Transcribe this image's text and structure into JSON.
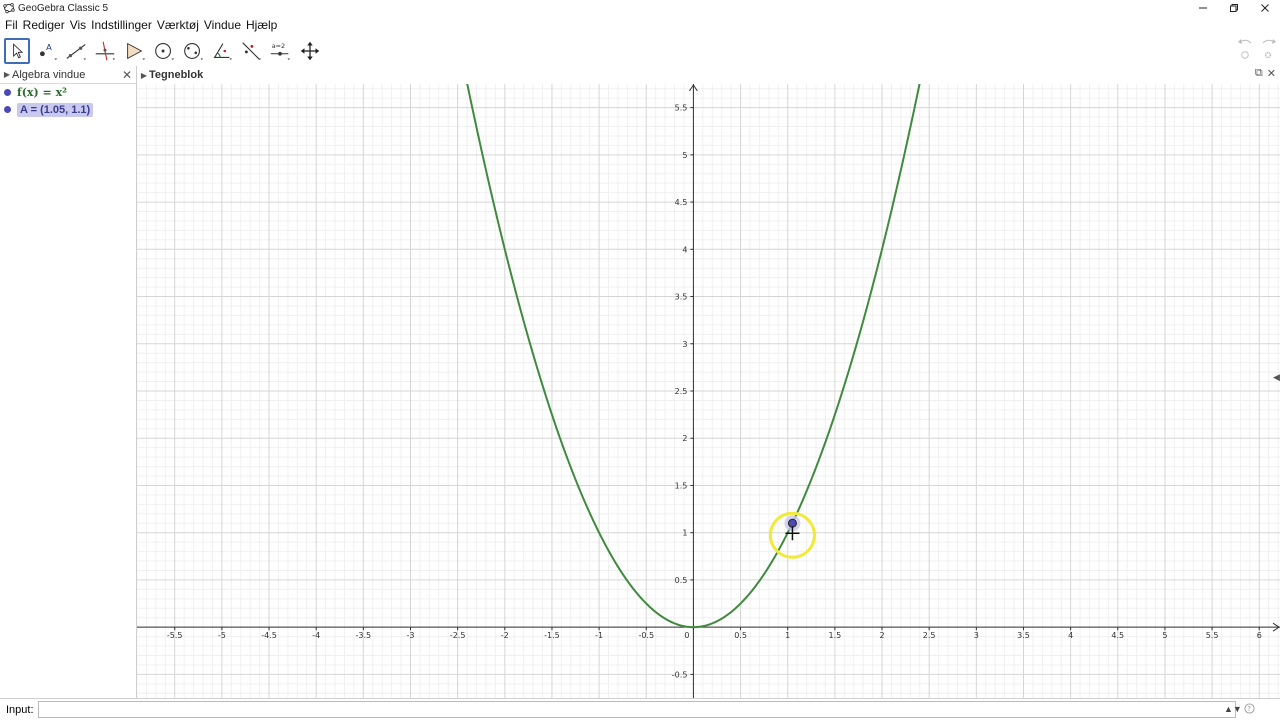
{
  "window": {
    "title": "GeoGebra Classic 5"
  },
  "menu": [
    "Fil",
    "Rediger",
    "Vis",
    "Indstillinger",
    "Værktøj",
    "Vindue",
    "Hjælp"
  ],
  "toolbar": {
    "tools": [
      "move",
      "point",
      "line",
      "perpendicular-line",
      "polygon",
      "circle",
      "ellipse",
      "angle",
      "reflect",
      "slider",
      "move-graphics-view"
    ],
    "slider_label": "a=2"
  },
  "algebra": {
    "title": "Algebra vindue",
    "items": [
      {
        "name": "f",
        "text": "f(x) = x²",
        "color": "#2a6a2a"
      },
      {
        "name": "A",
        "text": "A = (1.05, 1.1)",
        "color": "#3b3b8f",
        "selected": true
      }
    ]
  },
  "graphics": {
    "title": "Tegneblok",
    "function": "x^2",
    "curve_color": "#3f8a3f",
    "point_color": "#4a4ab5",
    "highlight_color": "#f2ea3a",
    "point": {
      "label": "A",
      "x": 1.05,
      "y": 1.1
    },
    "xlim": [
      -5.9,
      6.22
    ],
    "ylim": [
      -0.75,
      5.75
    ],
    "x_ticks": [
      "-5.5",
      "-5",
      "-4.5",
      "-4",
      "-3.5",
      "-3",
      "-2.5",
      "-2",
      "-1.5",
      "-1",
      "-0.5",
      "0",
      "0.5",
      "1",
      "1.5",
      "2",
      "2.5",
      "3",
      "3.5",
      "4",
      "4.5",
      "5",
      "5.5",
      "6"
    ],
    "y_ticks": [
      "-0.5",
      "0.5",
      "1",
      "1.5",
      "2",
      "2.5",
      "3",
      "3.5",
      "4",
      "4.5",
      "5",
      "5.5"
    ]
  },
  "input": {
    "label": "Input:",
    "value": ""
  }
}
